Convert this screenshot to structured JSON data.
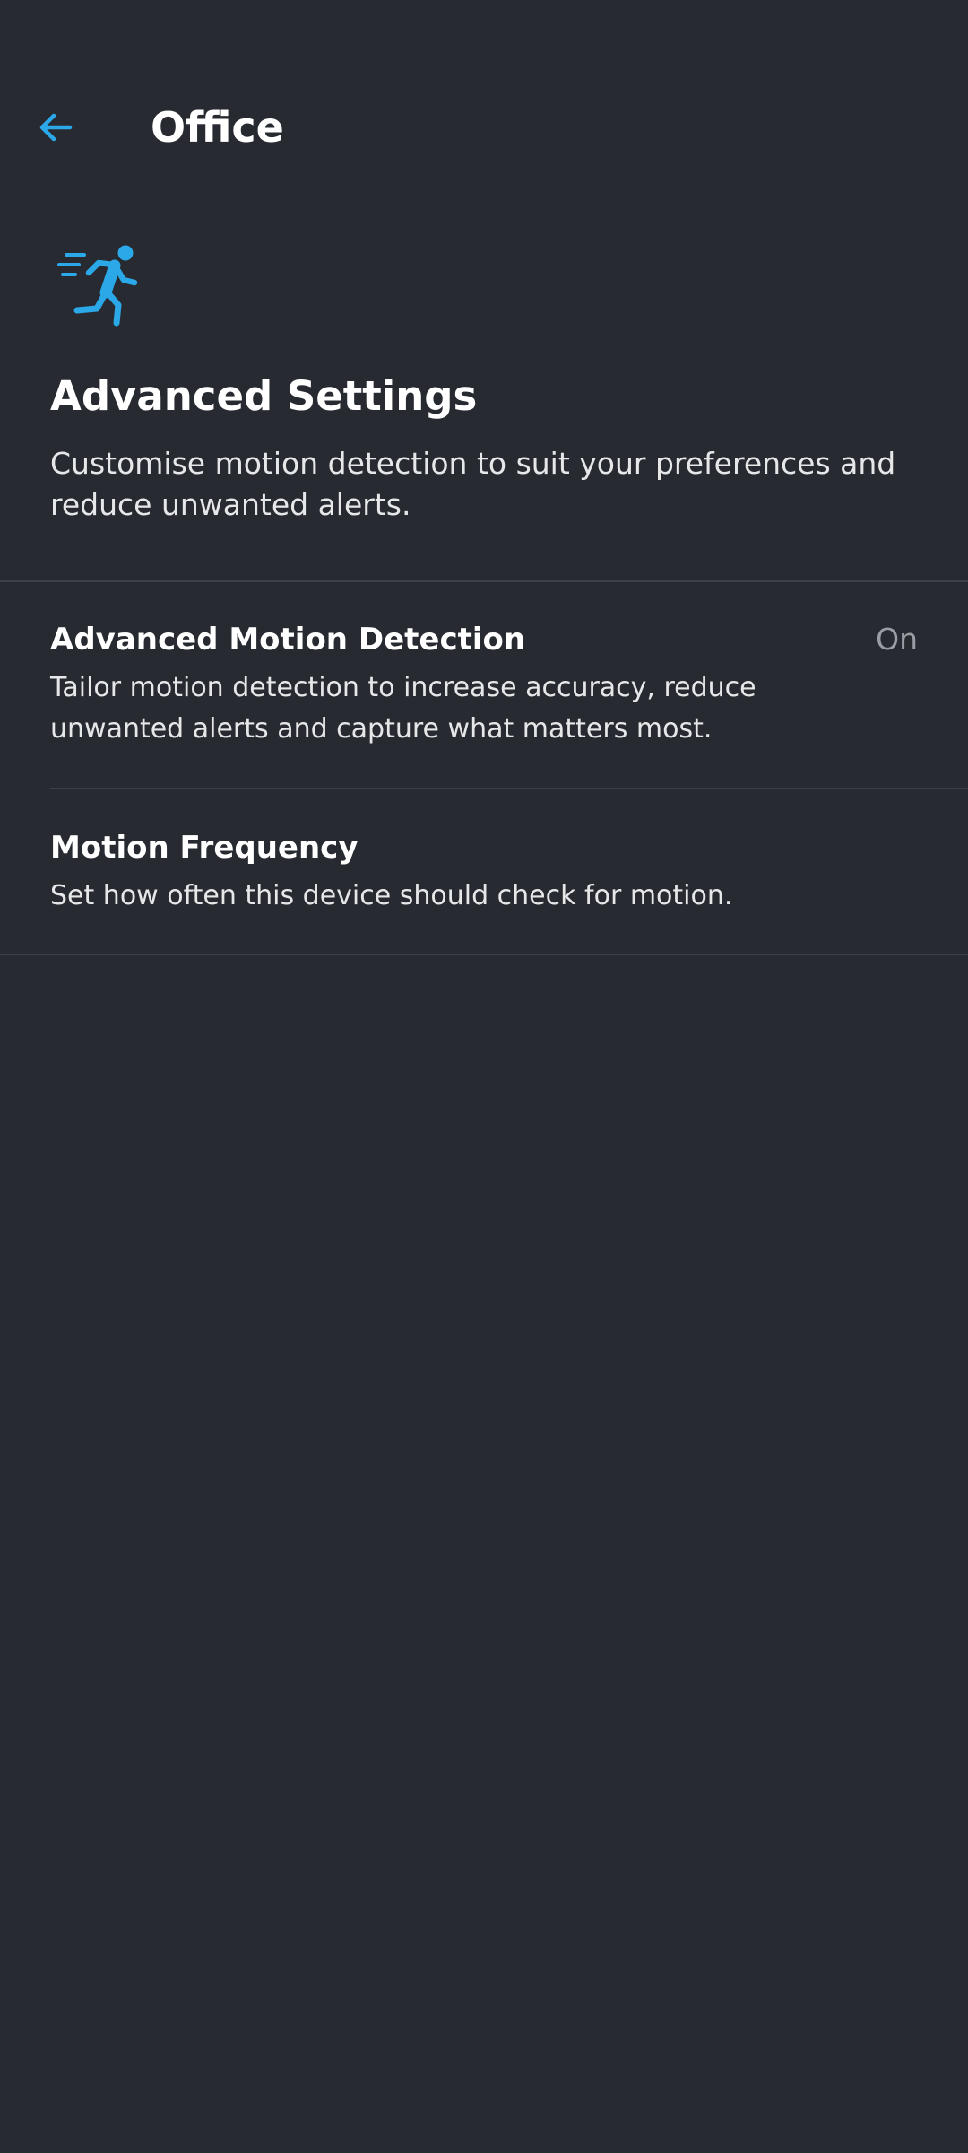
{
  "app_bar": {
    "title": "Office",
    "back_icon": "arrow-left-icon"
  },
  "colors": {
    "background": "#272a30",
    "accent": "#2ba8e8",
    "divider": "#3d4047",
    "value_text": "#9a9da3"
  },
  "header": {
    "icon": "running-person-motion-icon",
    "title": "Advanced Settings",
    "description": "Customise motion detection to suit your preferences and reduce unwanted alerts."
  },
  "settings": [
    {
      "title": "Advanced Motion Detection",
      "description": "Tailor motion detection to increase accuracy, reduce unwanted alerts and capture what matters most.",
      "value": "On"
    },
    {
      "title": "Motion Frequency",
      "description": "Set how often this device should check for motion."
    }
  ]
}
